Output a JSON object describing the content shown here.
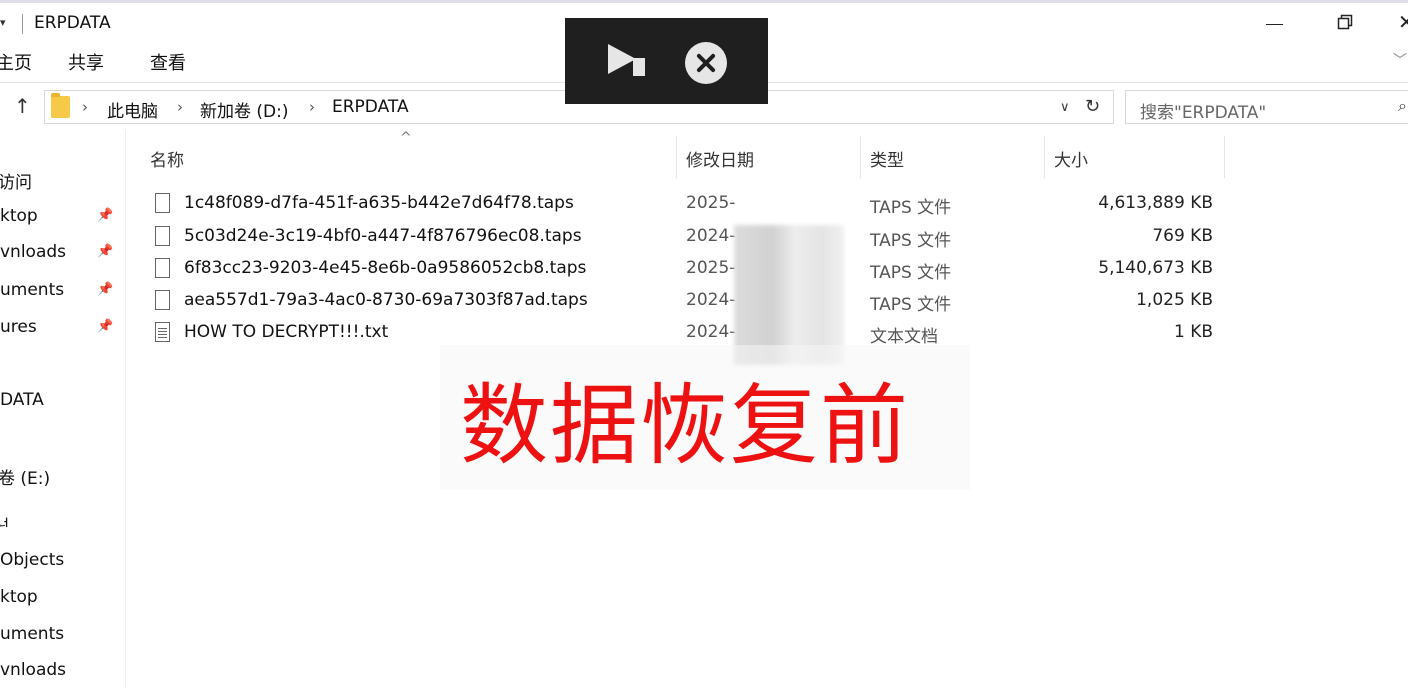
{
  "window": {
    "title": "ERPDATA",
    "quick_access_arrow": "▾"
  },
  "ribbon": {
    "tabs": [
      "主页",
      "共享",
      "查看"
    ]
  },
  "address": {
    "crumbs": [
      "此电脑",
      "新加卷 (D:)",
      "ERPDATA"
    ],
    "search_placeholder": "搜索\"ERPDATA\""
  },
  "nav": {
    "items": [
      {
        "label": "访问",
        "pinned": false
      },
      {
        "label": "ktop",
        "pinned": true
      },
      {
        "label": "vnloads",
        "pinned": true
      },
      {
        "label": "uments",
        "pinned": true
      },
      {
        "label": "ures",
        "pinned": true
      },
      {
        "label": "DATA",
        "pinned": false
      },
      {
        "label": "卷 (E:)",
        "pinned": false
      },
      {
        "label": "ᅿ",
        "pinned": false
      },
      {
        "label": "Objects",
        "pinned": false
      },
      {
        "label": "ktop",
        "pinned": false
      },
      {
        "label": "uments",
        "pinned": false
      },
      {
        "label": "vnloads",
        "pinned": false
      }
    ]
  },
  "columns": {
    "name": "名称",
    "modified": "修改日期",
    "type": "类型",
    "size": "大小"
  },
  "files": [
    {
      "name": "1c48f089-d7fa-451f-a635-b442e7d64f78.taps",
      "modified": "2025-",
      "type": "TAPS 文件",
      "size": "4,613,889 KB",
      "icon": "file-icon"
    },
    {
      "name": "5c03d24e-3c19-4bf0-a447-4f876796ec08.taps",
      "modified": "2024-",
      "type": "TAPS 文件",
      "size": "769 KB",
      "icon": "file-icon"
    },
    {
      "name": "6f83cc23-9203-4e45-8e6b-0a9586052cb8.taps",
      "modified": "2025-",
      "type": "TAPS 文件",
      "size": "5,140,673 KB",
      "icon": "file-icon"
    },
    {
      "name": "aea557d1-79a3-4ac0-8730-69a7303f87ad.taps",
      "modified": "2024-",
      "type": "TAPS 文件",
      "size": "1,025 KB",
      "icon": "file-icon"
    },
    {
      "name": "HOW TO DECRYPT!!!.txt",
      "modified": "2024-",
      "type": "文本文档",
      "size": "1 KB",
      "icon": "text-file-icon"
    }
  ],
  "overlay": {
    "play_icon": "play-skip-icon",
    "close_icon": "close-circle-icon"
  },
  "watermark": {
    "text": "数据恢复前",
    "color": "#ee1111"
  }
}
